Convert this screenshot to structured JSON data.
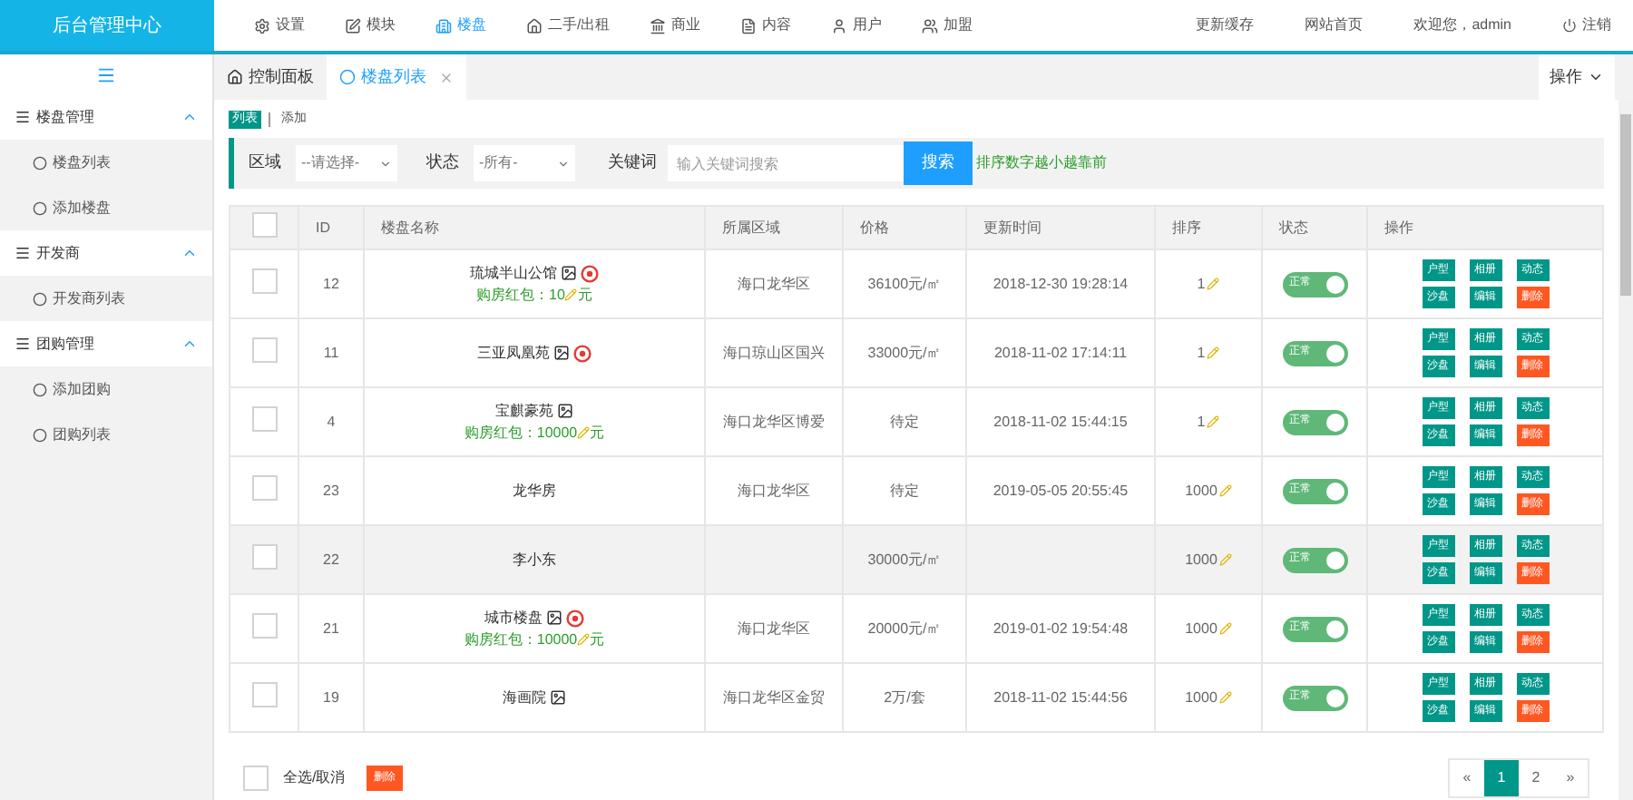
{
  "brand": "后台管理中心",
  "nav": [
    {
      "label": "设置",
      "selected": false
    },
    {
      "label": "模块",
      "selected": false
    },
    {
      "label": "楼盘",
      "selected": true
    },
    {
      "label": "二手/出租",
      "selected": false
    },
    {
      "label": "商业",
      "selected": false
    },
    {
      "label": "内容",
      "selected": false
    },
    {
      "label": "用户",
      "selected": false
    },
    {
      "label": "加盟",
      "selected": false
    }
  ],
  "top_links": [
    {
      "label": "更新缓存"
    },
    {
      "label": "网站首页"
    },
    {
      "label": "欢迎您，admin"
    },
    {
      "label": "注销"
    }
  ],
  "sidebar": [
    {
      "label": "楼盘管理",
      "expanded": true,
      "children": [
        {
          "label": "楼盘列表"
        },
        {
          "label": "添加楼盘"
        }
      ]
    },
    {
      "label": "开发商",
      "expanded": true,
      "children": [
        {
          "label": "开发商列表"
        }
      ]
    },
    {
      "label": "团购管理",
      "expanded": true,
      "children": [
        {
          "label": "添加团购"
        },
        {
          "label": "团购列表"
        }
      ]
    }
  ],
  "tabs": [
    {
      "label": "控制面板",
      "selected": false,
      "closable": false
    },
    {
      "label": "楼盘列表",
      "selected": true,
      "closable": true
    }
  ],
  "tab_menu": "操作",
  "subnav": [
    {
      "label": "列表",
      "selected": true
    },
    {
      "label": "添加",
      "selected": false
    }
  ],
  "filters": {
    "area_label": "区域",
    "area_value": "--请选择-",
    "status_label": "状态",
    "status_value": "-所有-",
    "keyword_label": "关键词",
    "keyword_placeholder": "输入关键词搜索",
    "search_button": "搜索",
    "hint": "排序数字越小越靠前"
  },
  "table": {
    "header_checked": false,
    "columns": [
      "ID",
      "楼盘名称",
      "所属区域",
      "价格",
      "更新时间",
      "排序",
      "状态",
      "操作"
    ],
    "rows": [
      {
        "checked": false,
        "highlighted": false,
        "id": "12",
        "name": "琉城半山公馆",
        "has_image": true,
        "has_badge": true,
        "bonus_prefix": "购房红包：",
        "bonus_amount": "10",
        "bonus_unit": "元",
        "area": "海口龙华区",
        "price": "36100元/㎡",
        "time": "2018-12-30 19:28:14",
        "sort": "1",
        "status": "正常",
        "on": true,
        "actions": [
          {
            "label": "户型",
            "kind": "normal"
          },
          {
            "label": "相册",
            "kind": "normal"
          },
          {
            "label": "动态",
            "kind": "normal"
          },
          {
            "label": "沙盘",
            "kind": "normal"
          },
          {
            "label": "编辑",
            "kind": "normal"
          },
          {
            "label": "删除",
            "kind": "danger"
          }
        ]
      },
      {
        "checked": false,
        "highlighted": false,
        "id": "11",
        "name": "三亚凤凰苑",
        "has_image": true,
        "has_badge": true,
        "area": "海口琼山区国兴",
        "price": "33000元/㎡",
        "time": "2018-11-02 17:14:11",
        "sort": "1",
        "status": "正常",
        "on": true,
        "actions": [
          {
            "label": "户型",
            "kind": "normal"
          },
          {
            "label": "相册",
            "kind": "normal"
          },
          {
            "label": "动态",
            "kind": "normal"
          },
          {
            "label": "沙盘",
            "kind": "normal"
          },
          {
            "label": "编辑",
            "kind": "normal"
          },
          {
            "label": "删除",
            "kind": "danger"
          }
        ]
      },
      {
        "checked": false,
        "highlighted": false,
        "id": "4",
        "name": "宝麒豪苑",
        "has_image": true,
        "has_badge": false,
        "bonus_prefix": "购房红包：",
        "bonus_amount": "10000",
        "bonus_unit": "元",
        "area": "海口龙华区博爱",
        "price": "待定",
        "time": "2018-11-02 15:44:15",
        "sort": "1",
        "status": "正常",
        "on": true,
        "actions": [
          {
            "label": "户型",
            "kind": "normal"
          },
          {
            "label": "相册",
            "kind": "normal"
          },
          {
            "label": "动态",
            "kind": "normal"
          },
          {
            "label": "沙盘",
            "kind": "normal"
          },
          {
            "label": "编辑",
            "kind": "normal"
          },
          {
            "label": "删除",
            "kind": "danger"
          }
        ]
      },
      {
        "checked": false,
        "highlighted": false,
        "id": "23",
        "name": "龙华房",
        "has_image": false,
        "has_badge": false,
        "area": "海口龙华区",
        "price": "待定",
        "time": "2019-05-05 20:55:45",
        "sort": "1000",
        "status": "正常",
        "on": true,
        "actions": [
          {
            "label": "户型",
            "kind": "normal"
          },
          {
            "label": "相册",
            "kind": "normal"
          },
          {
            "label": "动态",
            "kind": "normal"
          },
          {
            "label": "沙盘",
            "kind": "normal"
          },
          {
            "label": "编辑",
            "kind": "normal"
          },
          {
            "label": "删除",
            "kind": "danger"
          }
        ]
      },
      {
        "checked": false,
        "highlighted": true,
        "id": "22",
        "name": "李小东",
        "has_image": false,
        "has_badge": false,
        "price": "30000元/㎡",
        "sort": "1000",
        "status": "正常",
        "on": true,
        "actions": [
          {
            "label": "户型",
            "kind": "normal"
          },
          {
            "label": "相册",
            "kind": "normal"
          },
          {
            "label": "动态",
            "kind": "normal"
          },
          {
            "label": "沙盘",
            "kind": "normal"
          },
          {
            "label": "编辑",
            "kind": "normal"
          },
          {
            "label": "删除",
            "kind": "danger"
          }
        ]
      },
      {
        "checked": false,
        "highlighted": false,
        "id": "21",
        "name": "城市楼盘",
        "has_image": true,
        "has_badge": true,
        "bonus_prefix": "购房红包：",
        "bonus_amount": "10000",
        "bonus_unit": "元",
        "area": "海口龙华区",
        "price": "20000元/㎡",
        "time": "2019-01-02 19:54:48",
        "sort": "1000",
        "status": "正常",
        "on": true,
        "actions": [
          {
            "label": "户型",
            "kind": "normal"
          },
          {
            "label": "相册",
            "kind": "normal"
          },
          {
            "label": "动态",
            "kind": "normal"
          },
          {
            "label": "沙盘",
            "kind": "normal"
          },
          {
            "label": "编辑",
            "kind": "normal"
          },
          {
            "label": "删除",
            "kind": "danger"
          }
        ]
      },
      {
        "checked": false,
        "highlighted": false,
        "id": "19",
        "name": "海画院",
        "has_image": true,
        "has_badge": false,
        "area": "海口龙华区金贸",
        "price": "2万/套",
        "time": "2018-11-02 15:44:56",
        "sort": "1000",
        "status": "正常",
        "on": true,
        "actions": [
          {
            "label": "户型",
            "kind": "normal"
          },
          {
            "label": "相册",
            "kind": "normal"
          },
          {
            "label": "动态",
            "kind": "normal"
          },
          {
            "label": "沙盘",
            "kind": "normal"
          },
          {
            "label": "编辑",
            "kind": "normal"
          },
          {
            "label": "删除",
            "kind": "danger"
          }
        ]
      }
    ]
  },
  "footer": {
    "select_all": "全选/取消",
    "select_all_checked": false,
    "delete_button": "删除"
  },
  "pagination": [
    {
      "label": "«",
      "selected": false
    },
    {
      "label": "1",
      "selected": true
    },
    {
      "label": "2",
      "selected": false
    },
    {
      "label": "»",
      "selected": false
    }
  ]
}
